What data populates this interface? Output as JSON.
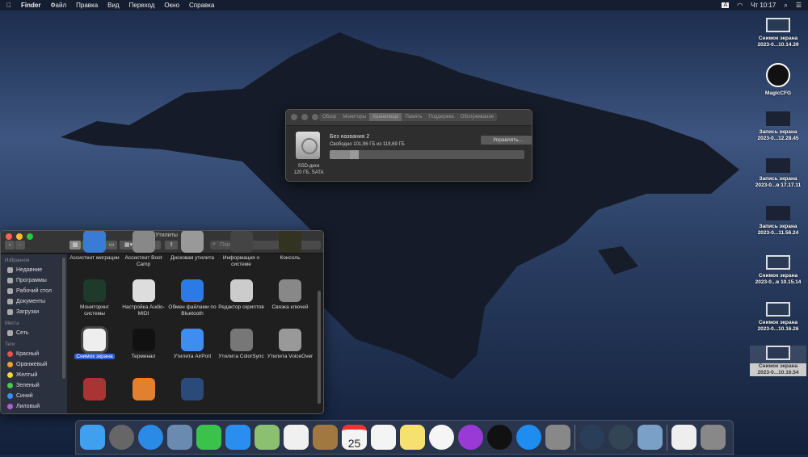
{
  "menubar": {
    "apple": "",
    "app": "Finder",
    "items": [
      "Файл",
      "Правка",
      "Вид",
      "Переход",
      "Окно",
      "Справка"
    ],
    "input_badge": "A",
    "clock": "Чт 10:17"
  },
  "about": {
    "tabs": [
      "Обзор",
      "Мониторы",
      "Хранилище",
      "Память",
      "Поддержка",
      "Обслуживание"
    ],
    "selected_tab": "Хранилище",
    "volume_name": "Без названия 2",
    "free_text": "Свободно 101,96 ГБ из 119,69 ГБ",
    "manage_button": "Управлять...",
    "disk_label_1": "SSD-диск",
    "disk_label_2": "120 ГБ, SATA",
    "used_fraction": 0.148
  },
  "finder": {
    "title": "Утилиты",
    "search_placeholder": "Поиск",
    "sidebar": {
      "favorites_header": "Избранное",
      "favorites": [
        "Недавние",
        "Программы",
        "Рабочий стол",
        "Документы",
        "Загрузки"
      ],
      "places_header": "Места",
      "places": [
        "Сеть"
      ],
      "tags_header": "Теги",
      "tags": [
        {
          "label": "Красный",
          "color": "#e5534b"
        },
        {
          "label": "Оранжевый",
          "color": "#f0a030"
        },
        {
          "label": "Желтый",
          "color": "#f2d43c"
        },
        {
          "label": "Зеленый",
          "color": "#4cc94c"
        },
        {
          "label": "Синий",
          "color": "#3d8ef0"
        },
        {
          "label": "Лиловый",
          "color": "#b05cd6"
        }
      ]
    },
    "apps": [
      {
        "label": "Ассистент миграции",
        "color": "#3a7bd5"
      },
      {
        "label": "Ассистент Boot Camp",
        "color": "#888"
      },
      {
        "label": "Дисковая утилита",
        "color": "#999"
      },
      {
        "label": "Информация о системе",
        "color": "#444"
      },
      {
        "label": "Консоль",
        "color": "#332"
      },
      {
        "label": "Мониторинг системы",
        "color": "#1e3a2a"
      },
      {
        "label": "Настройка Audio-MIDI",
        "color": "#ddd"
      },
      {
        "label": "Обмен файлами по Bluetooth",
        "color": "#2a7be6"
      },
      {
        "label": "Редактор скриптов",
        "color": "#ccc"
      },
      {
        "label": "Связка ключей",
        "color": "#888"
      },
      {
        "label": "Снимок экрана",
        "color": "#eee"
      },
      {
        "label": "Терминал",
        "color": "#111"
      },
      {
        "label": "Утилита AirPort",
        "color": "#3d8ef0"
      },
      {
        "label": "Утилита ColorSync",
        "color": "#777"
      },
      {
        "label": "Утилита VoiceOver",
        "color": "#999"
      },
      {
        "label": "",
        "color": "#a33"
      },
      {
        "label": "",
        "color": "#e08030"
      },
      {
        "label": "",
        "color": "#2a4a7a"
      }
    ],
    "selected_app": "Снимок экрана"
  },
  "desktop_icons": [
    {
      "line1": "Снимок экрана",
      "line2": "2023-0...10.14.39"
    },
    {
      "line1": "MagicCFG",
      "line2": ""
    },
    {
      "line1": "Запись экрана",
      "line2": "2023-0...12.28.45"
    },
    {
      "line1": "Запись экрана",
      "line2": "2023-0...в 17.17.11"
    },
    {
      "line1": "Запись экрана",
      "line2": "2023-0...11.56.24"
    },
    {
      "line1": "Снимок экрана",
      "line2": "2023-0...в 10.15.14"
    },
    {
      "line1": "Снимок экрана",
      "line2": "2023-0...10.16.26"
    },
    {
      "line1": "Снимок экрана",
      "line2": "2023-0...10.16.54"
    }
  ],
  "dock": [
    {
      "name": "finder",
      "color": "#3fa0f0"
    },
    {
      "name": "launchpad",
      "color": "#666"
    },
    {
      "name": "safari",
      "color": "#2a8ae6"
    },
    {
      "name": "mail",
      "color": "#6a8ab0"
    },
    {
      "name": "facetime",
      "color": "#3bc24a"
    },
    {
      "name": "messages",
      "color": "#2a8ef0"
    },
    {
      "name": "maps",
      "color": "#8ac070"
    },
    {
      "name": "photos",
      "color": "#f0f0f0"
    },
    {
      "name": "contacts",
      "color": "#a07840"
    },
    {
      "name": "calendar",
      "color": "#f4f4f4",
      "text": "25"
    },
    {
      "name": "reminders",
      "color": "#f4f4f4"
    },
    {
      "name": "notes",
      "color": "#f5e070"
    },
    {
      "name": "music",
      "color": "#f5f5f5"
    },
    {
      "name": "podcasts",
      "color": "#9a3ad6"
    },
    {
      "name": "apple-tv",
      "color": "#111"
    },
    {
      "name": "app-store",
      "color": "#1f8cf0"
    },
    {
      "name": "system-preferences",
      "color": "#888"
    },
    {
      "name": "sep"
    },
    {
      "name": "quicktime",
      "color": "#2a3e5a"
    },
    {
      "name": "migration",
      "color": "#345"
    },
    {
      "name": "preview",
      "color": "#7aa0c8"
    },
    {
      "name": "sep"
    },
    {
      "name": "document",
      "color": "#eee"
    },
    {
      "name": "trash",
      "color": "#888"
    }
  ],
  "colors": {
    "accent": "#2a5ed6",
    "close": "#ff5f57",
    "minimize": "#febc2e",
    "zoom": "#28c840"
  }
}
